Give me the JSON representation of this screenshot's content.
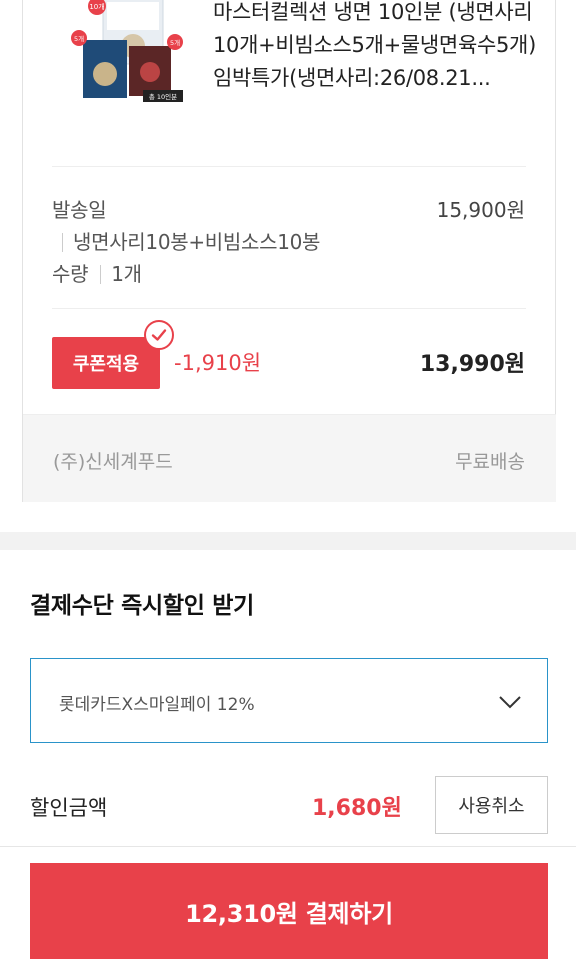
{
  "product": {
    "title": "마스터컬렉션 냉면 10인분 (냉면사리10개+비빔소스5개+물냉면육수5개) 임박특가(냉면사리:26/08.21...",
    "image_badges": {
      "top": "10개",
      "left": "5개",
      "right": "5개",
      "bottom": "총 10인분"
    },
    "ship_label": "발송일",
    "option_text": "냉면사리10봉+비빔소스10봉",
    "qty_label": "수량",
    "qty_value": "1개",
    "original_price": "15,900원",
    "coupon_label": "쿠폰적용",
    "discount": "-1,910원",
    "final_price": "13,990원",
    "seller": "(주)신세계푸드",
    "shipping": "무료배송"
  },
  "payment": {
    "section_title": "결제수단 즉시할인 받기",
    "card_option": "롯데카드X스마일페이 12%",
    "discount_label": "할인금액",
    "discount_amount": "1,680원",
    "cancel_label": "사용취소",
    "pay_button": "12,310원 결제하기"
  },
  "colors": {
    "accent": "#e8414a",
    "select_border": "#2a93c9"
  }
}
